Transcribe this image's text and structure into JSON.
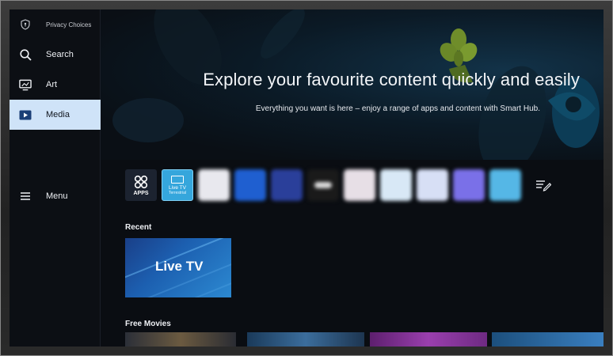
{
  "sidebar": {
    "privacy_label": "Privacy Choices",
    "items": [
      {
        "label": "Search",
        "icon": "search-icon"
      },
      {
        "label": "Art",
        "icon": "art-icon"
      },
      {
        "label": "Media",
        "icon": "media-icon",
        "active": true
      },
      {
        "label": "Menu",
        "icon": "menu-icon"
      }
    ]
  },
  "hero": {
    "title": "Explore your favourite content quickly and easily",
    "subtitle": "Everything you want is here – enjoy a range of apps and content with Smart Hub."
  },
  "apps_row": {
    "apps_label": "APPS",
    "live_tv_label": "Live TV",
    "live_tv_sublabel": "Terrestrial",
    "blurred_tile_colors": [
      "#e8e8ee",
      "#1f5fd0",
      "#2a3f9a",
      "#1a1a1a",
      "#e7dfe6",
      "#d8e8f6",
      "#d7dff5",
      "#7a70e8",
      "#55b7e6"
    ]
  },
  "recent": {
    "heading": "Recent",
    "card_label": "Live TV"
  },
  "free_movies": {
    "heading": "Free Movies"
  },
  "colors": {
    "accent_active": "#cfe3f8",
    "live_tv_tile": "#35a6dc",
    "background": "#0a0d12"
  }
}
